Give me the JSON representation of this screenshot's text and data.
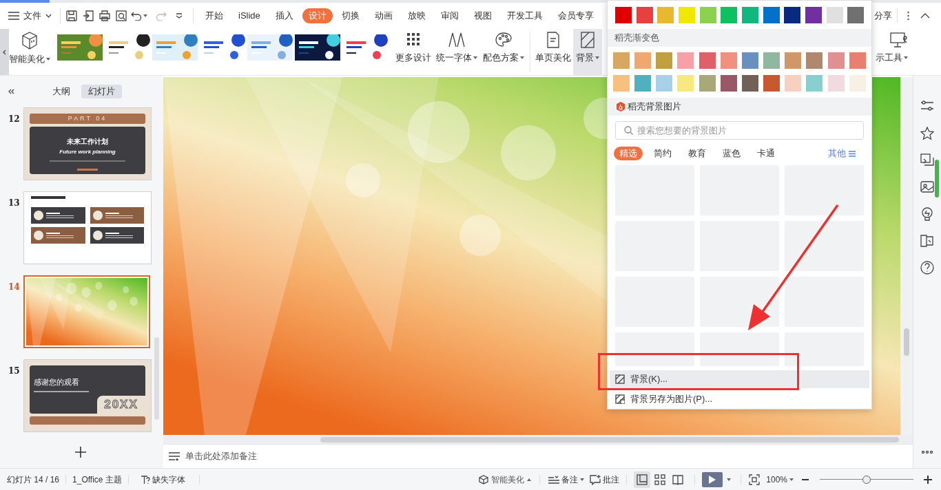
{
  "menu_bar": {
    "file_menu": "文件",
    "tabs": [
      {
        "label": "开始",
        "selected": false
      },
      {
        "label": "iSlide",
        "selected": false
      },
      {
        "label": "插入",
        "selected": false
      },
      {
        "label": "设计",
        "selected": true
      },
      {
        "label": "切换",
        "selected": false
      },
      {
        "label": "动画",
        "selected": false
      },
      {
        "label": "放映",
        "selected": false
      },
      {
        "label": "审阅",
        "selected": false
      },
      {
        "label": "视图",
        "selected": false
      },
      {
        "label": "开发工具",
        "selected": false
      },
      {
        "label": "会员专享",
        "selected": false
      }
    ],
    "share": "分享"
  },
  "ribbon": {
    "smart_beautify": "智能美化",
    "tools": [
      {
        "label": "更多设计",
        "dropdown": false,
        "selected": false
      },
      {
        "label": "统一字体",
        "dropdown": true,
        "selected": false
      },
      {
        "label": "配色方案",
        "dropdown": true,
        "selected": false
      },
      {
        "label": "单页美化",
        "dropdown": false,
        "selected": false
      },
      {
        "label": "背景",
        "dropdown": true,
        "selected": true
      }
    ],
    "presenter_tools": "示工具"
  },
  "left_panel": {
    "tabs": [
      {
        "label": "大纲",
        "selected": false
      },
      {
        "label": "幻灯片",
        "selected": true
      }
    ],
    "slides": [
      {
        "number": "12",
        "selected": false,
        "kind": "section",
        "header": "PART 04",
        "title": "未来工作计划",
        "subtitle": "Future work planning"
      },
      {
        "number": "13",
        "selected": false,
        "kind": "cards"
      },
      {
        "number": "14",
        "selected": true,
        "kind": "picture"
      },
      {
        "number": "15",
        "selected": false,
        "kind": "closing",
        "title": "感谢您的观看",
        "year": "20XX"
      }
    ]
  },
  "notes": {
    "placeholder": "单击此处添加备注"
  },
  "status_bar": {
    "slide": "幻灯片 14 / 16",
    "theme": "1_Office 主题",
    "missing_fonts": "缺失字体",
    "smart_beautify": "智能美化",
    "notes": "备注",
    "comments": "批注",
    "views": [
      {
        "selected": true
      },
      {
        "selected": false
      },
      {
        "selected": false
      }
    ],
    "zoom": "100%",
    "zoom_slider": {
      "level": 0.5
    }
  },
  "background_menu": {
    "swatches": [
      {
        "color": "#e00000"
      },
      {
        "color": "#e84040"
      },
      {
        "color": "#e8b830"
      },
      {
        "color": "#f0e800"
      },
      {
        "color": "#8cd050"
      },
      {
        "color": "#10c060"
      },
      {
        "color": "#10b880"
      },
      {
        "color": "#0070c8"
      },
      {
        "color": "#0a2a80"
      },
      {
        "color": "#7030a0"
      },
      {
        "color": "#e0e0e0"
      },
      {
        "color": "#707070"
      }
    ],
    "gradient_title": "稻壳渐变色",
    "gradients": [
      {
        "color": "#d8a860"
      },
      {
        "color": "#f0a870"
      },
      {
        "color": "#c0a040"
      },
      {
        "color": "#f8a0a8"
      },
      {
        "color": "#e06068"
      },
      {
        "color": "#f09080"
      },
      {
        "color": "#6890c0"
      },
      {
        "color": "#90b8a0"
      },
      {
        "color": "#d09868"
      },
      {
        "color": "#b08870"
      },
      {
        "color": "#e09090"
      },
      {
        "color": "#e88070"
      },
      {
        "color": "#f8c080"
      },
      {
        "color": "#50b0c0"
      },
      {
        "color": "#a8d0e8"
      },
      {
        "color": "#f8e880"
      },
      {
        "color": "#a8a878"
      },
      {
        "color": "#985868"
      },
      {
        "color": "#706058"
      },
      {
        "color": "#c85830"
      },
      {
        "color": "#f8d0c0"
      },
      {
        "color": "#88d0d0"
      },
      {
        "color": "#f0dce0"
      },
      {
        "color": "#f8f0e4"
      }
    ],
    "pictures_title": "稻壳背景图片",
    "search": {
      "placeholder": "搜索您想要的背景图片"
    },
    "categories": [
      {
        "label": "精选",
        "selected": true
      },
      {
        "label": "简约",
        "selected": false
      },
      {
        "label": "教育",
        "selected": false
      },
      {
        "label": "蓝色",
        "selected": false
      },
      {
        "label": "卡通",
        "selected": false
      }
    ],
    "more": "其他",
    "items": [
      {
        "label": "背景(K)...",
        "highlighted": true
      },
      {
        "label": "背景另存为图片(P)...",
        "highlighted": false
      }
    ]
  }
}
